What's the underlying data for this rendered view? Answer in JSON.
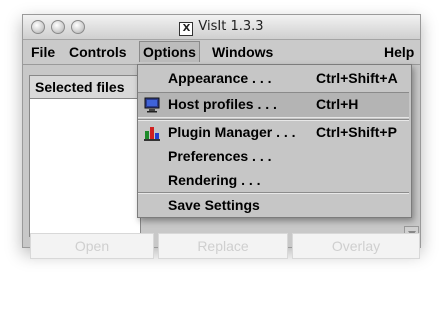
{
  "window": {
    "title": "VisIt 1.3.3",
    "title_icon": "X"
  },
  "menubar": {
    "file": "File",
    "controls": "Controls",
    "options": "Options",
    "windows": "Windows",
    "help": "Help"
  },
  "panel": {
    "header": "Selected files"
  },
  "buttons": {
    "open": "Open",
    "replace": "Replace",
    "overlay": "Overlay"
  },
  "options_menu": {
    "items": [
      {
        "label": "Appearance . . .",
        "shortcut": "Ctrl+Shift+A"
      },
      {
        "label": "Host profiles . . .",
        "shortcut": "Ctrl+H",
        "icon": "monitor-icon"
      },
      {
        "label": "Plugin Manager . . .",
        "shortcut": "Ctrl+Shift+P",
        "icon": "plugin-icon"
      },
      {
        "label": "Preferences . . ."
      },
      {
        "label": "Rendering . . ."
      },
      {
        "label": "Save Settings"
      }
    ]
  },
  "colors": {
    "menu_bg": "#c6c6c6",
    "selected_item_bg": "#b4b4b4",
    "window_bg": "#c8c8c8"
  }
}
